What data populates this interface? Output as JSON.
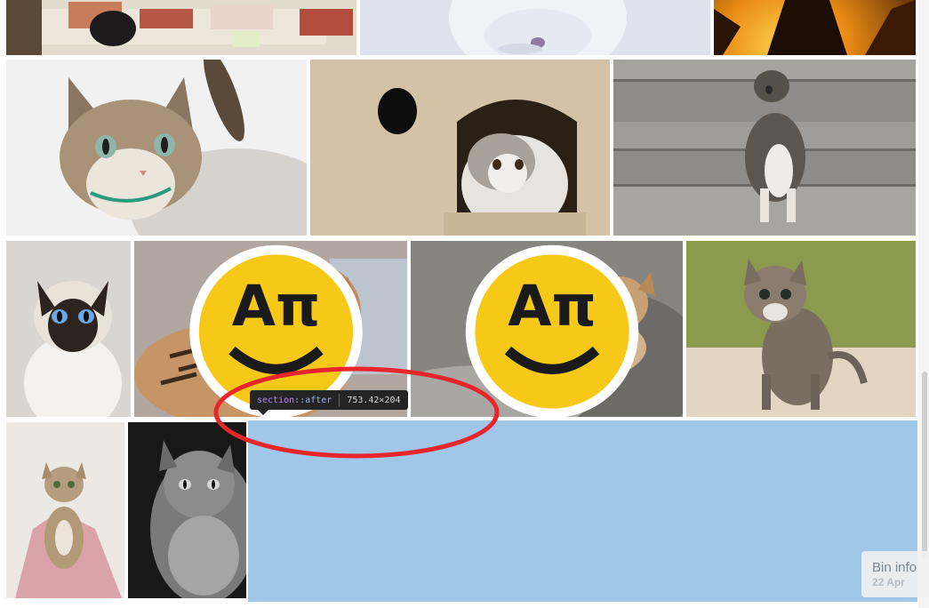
{
  "gallery": {
    "tiles": [
      {
        "name": "cat-on-sofa-photo",
        "badge": false
      },
      {
        "name": "white-kitten-photo",
        "badge": false
      },
      {
        "name": "cat-silhouette-sunset-photo",
        "badge": false
      },
      {
        "name": "tabby-cat-closeup-photo",
        "badge": false
      },
      {
        "name": "fluffy-kitten-cat-house-photo",
        "badge": false
      },
      {
        "name": "tabby-kitten-on-steps-photo",
        "badge": false
      },
      {
        "name": "siamese-cat-photo",
        "badge": false
      },
      {
        "name": "two-bengal-kittens-photo",
        "badge": true
      },
      {
        "name": "bengal-kitten-lying-photo",
        "badge": true
      },
      {
        "name": "tabby-kitten-grass-photo",
        "badge": false
      },
      {
        "name": "kitten-pink-blanket-photo",
        "badge": false
      },
      {
        "name": "grayscale-longhair-cat-photo",
        "badge": false
      }
    ]
  },
  "devtools_tooltip": {
    "selector": "section",
    "pseudo": "::after",
    "dimensions": "753.42×204"
  },
  "bin_info": {
    "title": "Bin info",
    "date": "22 Apr"
  },
  "colors": {
    "highlight": "#a0c3e8",
    "tooltip_bg": "#242424",
    "annotation_circle": "#e8252b"
  }
}
